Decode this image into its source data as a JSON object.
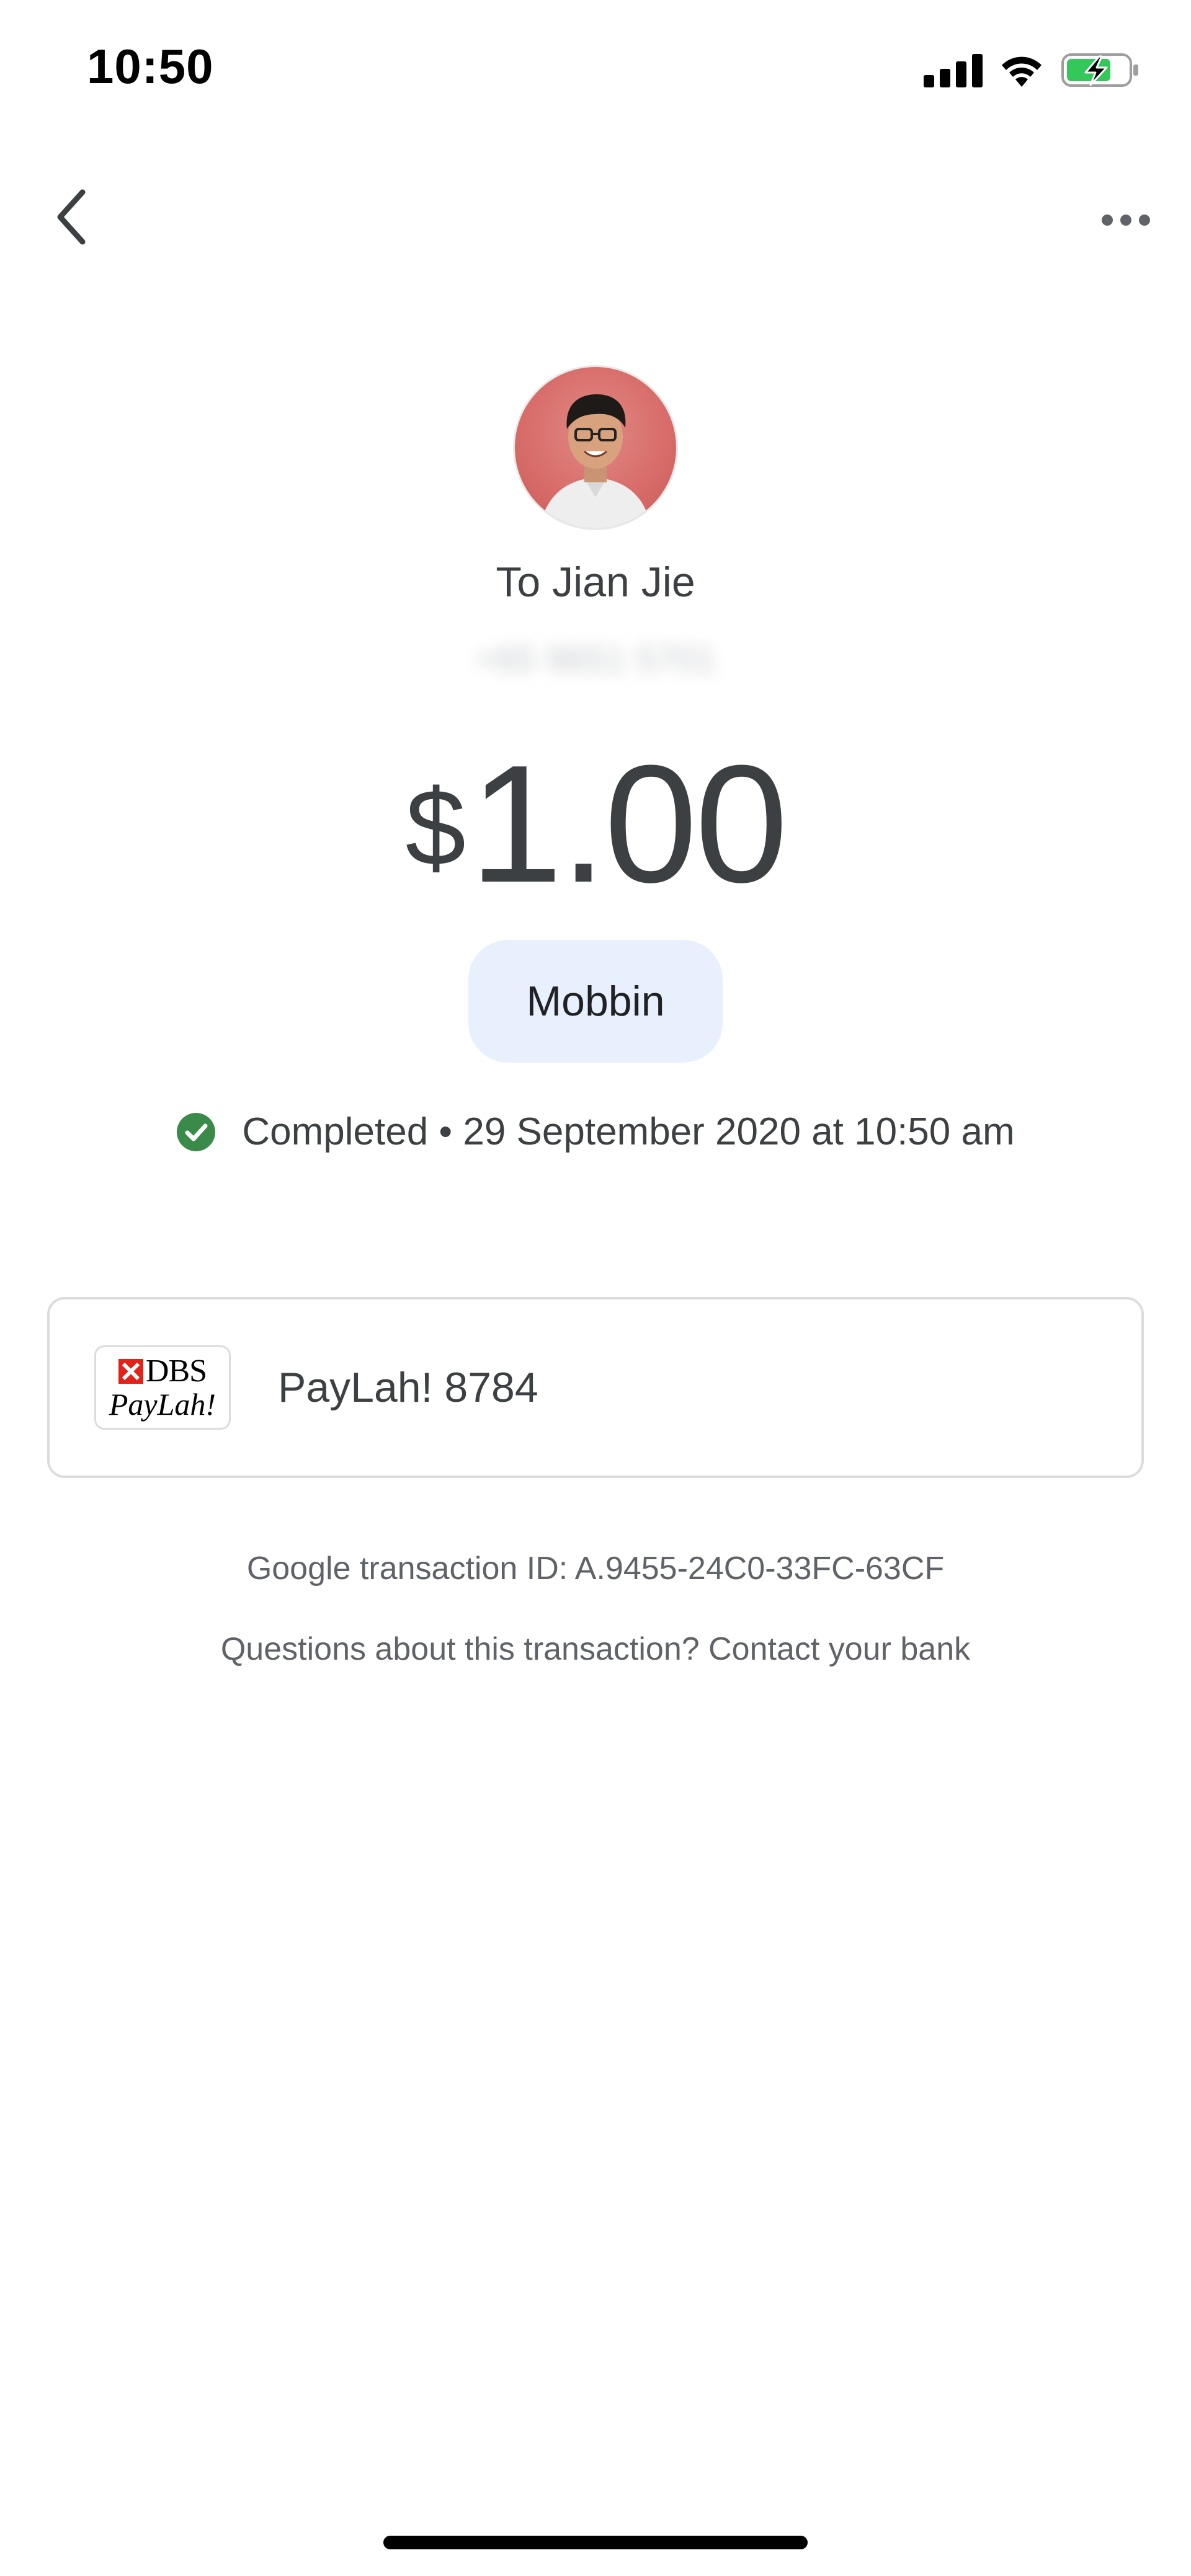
{
  "status_bar": {
    "time": "10:50",
    "icons": [
      "signal-icon",
      "wifi-icon",
      "battery-charging-icon"
    ]
  },
  "nav": {
    "back_icon": "chevron-left-icon",
    "more_icon": "more-horizontal-icon"
  },
  "recipient": {
    "avatar": "avatar-photo",
    "name": "To Jian Jie",
    "phone": "+65 9651 5701"
  },
  "amount": {
    "currency": "$",
    "value": "1.00"
  },
  "note": {
    "label": "Mobbin"
  },
  "status": {
    "icon": "check-circle-icon",
    "text": "Completed • 29 September 2020 at 10:50 am",
    "color": "#3a8a4a"
  },
  "payment_method": {
    "logo_top": "DBS",
    "logo_bottom": "PayLah!",
    "label": "PayLah! 8784"
  },
  "footer": {
    "transaction_id": "Google transaction ID: A.9455-24C0-33FC-63CF",
    "questions": "Questions about this transaction? Contact your bank"
  },
  "colors": {
    "chip_background": "#e8f0fe",
    "avatar_background": "#d86d6a",
    "card_border": "#dadce0",
    "text_primary": "#3c4043",
    "text_secondary": "#5f6368"
  }
}
